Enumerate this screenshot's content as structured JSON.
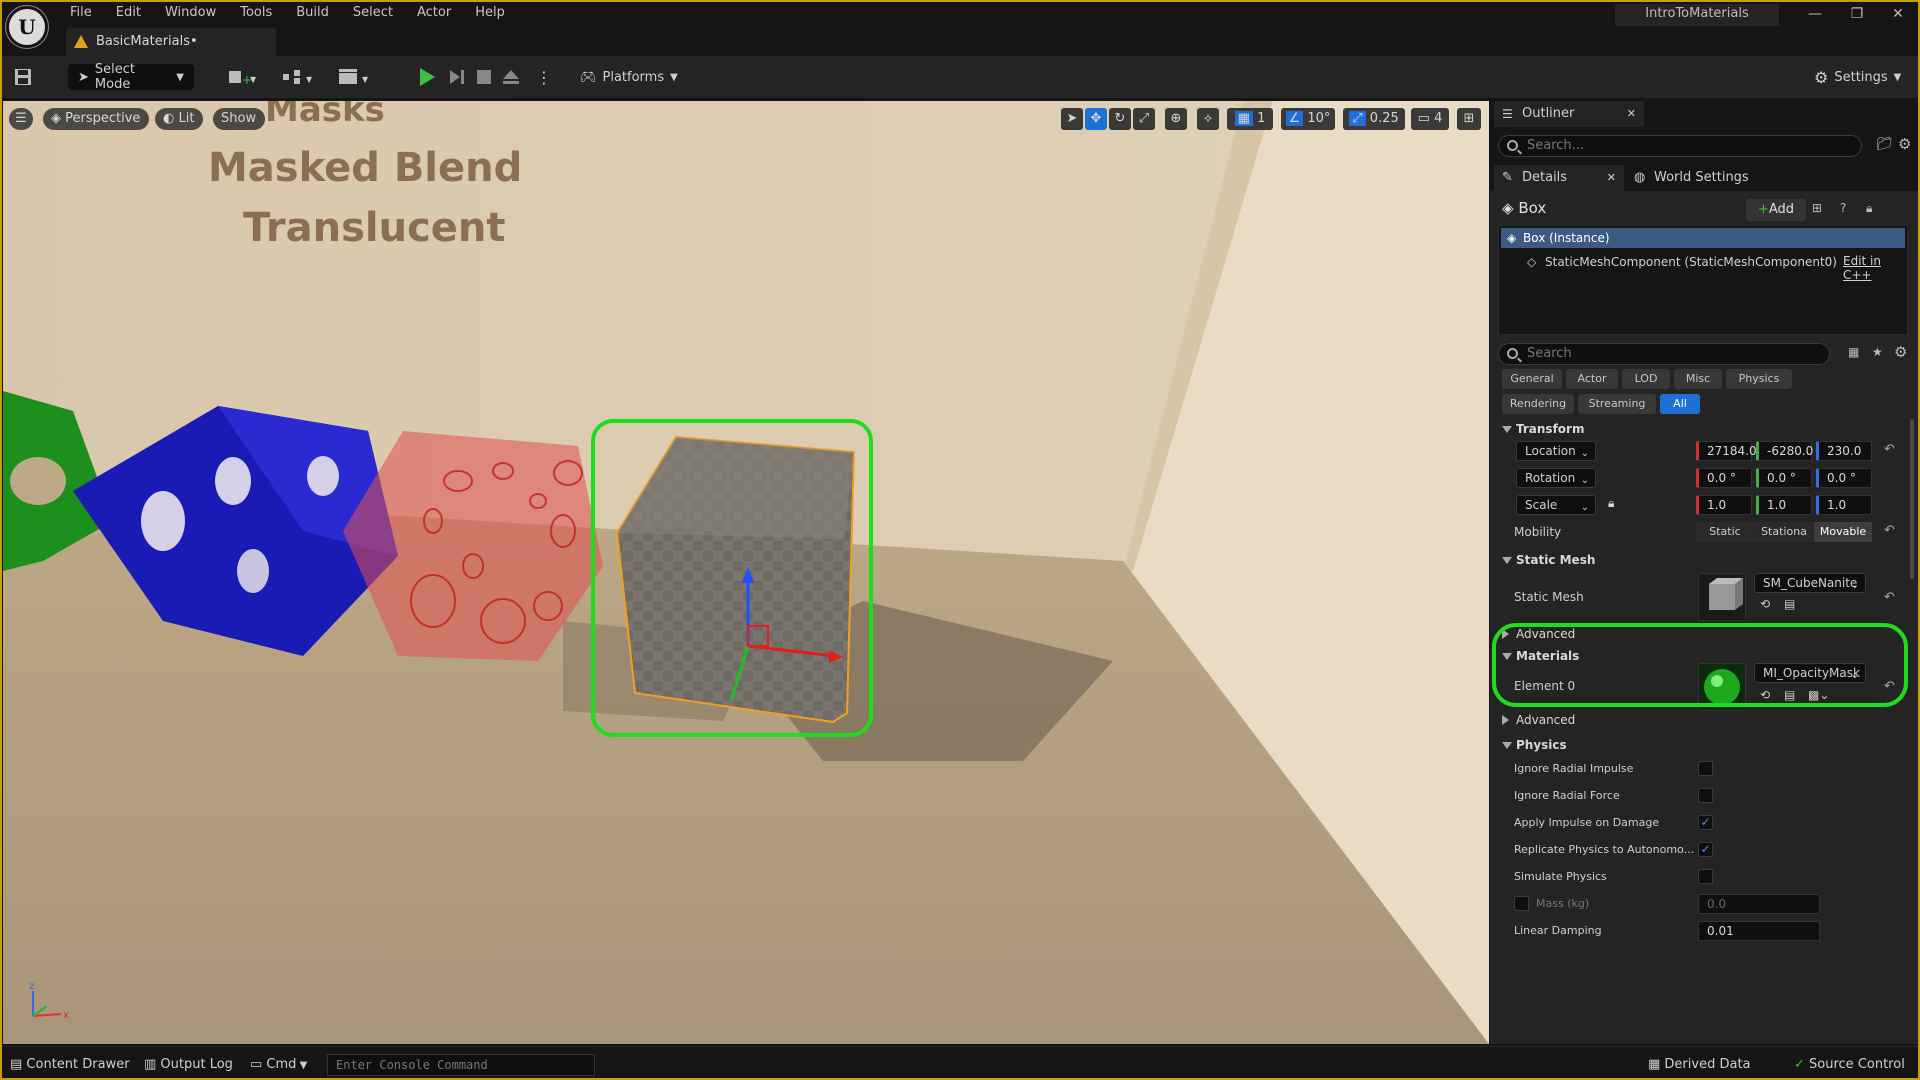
{
  "menu": [
    "File",
    "Edit",
    "Window",
    "Tools",
    "Build",
    "Select",
    "Actor",
    "Help"
  ],
  "project_title": "IntroToMaterials",
  "document_tab": "BasicMaterials•",
  "toolbar": {
    "select_mode": "Select Mode",
    "platforms": "Platforms",
    "settings": "Settings"
  },
  "viewport": {
    "perspective": "Perspective",
    "lit": "Lit",
    "show": "Show",
    "rotation_snap": "10°",
    "scale_snap": "0.25",
    "grid_snap": "1",
    "camera_speed": "4",
    "wall_text": [
      "Masks",
      "Masked Blend",
      "Translucent"
    ]
  },
  "outliner": {
    "tab": "Outliner",
    "search_placeholder": "Search..."
  },
  "details": {
    "tab": "Details",
    "world_settings_tab": "World Settings",
    "actor_name": "Box",
    "add_button": "Add",
    "instance_row": "Box (Instance)",
    "component_row": "StaticMeshComponent (StaticMeshComponent0)",
    "edit_cpp": "Edit in C++",
    "search_placeholder": "Search",
    "filters_row1": [
      "General",
      "Actor",
      "LOD",
      "Misc",
      "Physics"
    ],
    "filters_row2": [
      "Rendering",
      "Streaming",
      "All"
    ],
    "transform": {
      "header": "Transform",
      "location_label": "Location",
      "location": [
        "27184.0",
        "-6280.0",
        "230.0"
      ],
      "rotation_label": "Rotation",
      "rotation": [
        "0.0 °",
        "0.0 °",
        "0.0 °"
      ],
      "scale_label": "Scale",
      "scale": [
        "1.0",
        "1.0",
        "1.0"
      ],
      "mobility_label": "Mobility",
      "mobility_options": [
        "Static",
        "Stationa",
        "Movable"
      ]
    },
    "static_mesh": {
      "header": "Static Mesh",
      "label": "Static Mesh",
      "value": "SM_CubeNanite",
      "advanced": "Advanced"
    },
    "materials": {
      "header": "Materials",
      "element_label": "Element 0",
      "value": "MI_OpacityMask",
      "advanced": "Advanced"
    },
    "physics": {
      "header": "Physics",
      "rows": [
        {
          "label": "Ignore Radial Impulse",
          "checked": false
        },
        {
          "label": "Ignore Radial Force",
          "checked": false
        },
        {
          "label": "Apply Impulse on Damage",
          "checked": true
        },
        {
          "label": "Replicate Physics to Autonomo...",
          "checked": true
        },
        {
          "label": "Simulate Physics",
          "checked": false
        }
      ],
      "mass_label": "Mass (kg)",
      "mass_value": "0.0",
      "linear_damping_label": "Linear Damping",
      "linear_damping_value": "0.01"
    }
  },
  "statusbar": {
    "content_drawer": "Content Drawer",
    "output_log": "Output Log",
    "cmd": "Cmd",
    "console_placeholder": "Enter Console Command",
    "derived_data": "Derived Data",
    "source_control": "Source Control"
  },
  "colors": {
    "accent_blue": "#1f6fd6",
    "highlight_green": "#1fdc1f",
    "selection_orange": "#f0a020"
  }
}
